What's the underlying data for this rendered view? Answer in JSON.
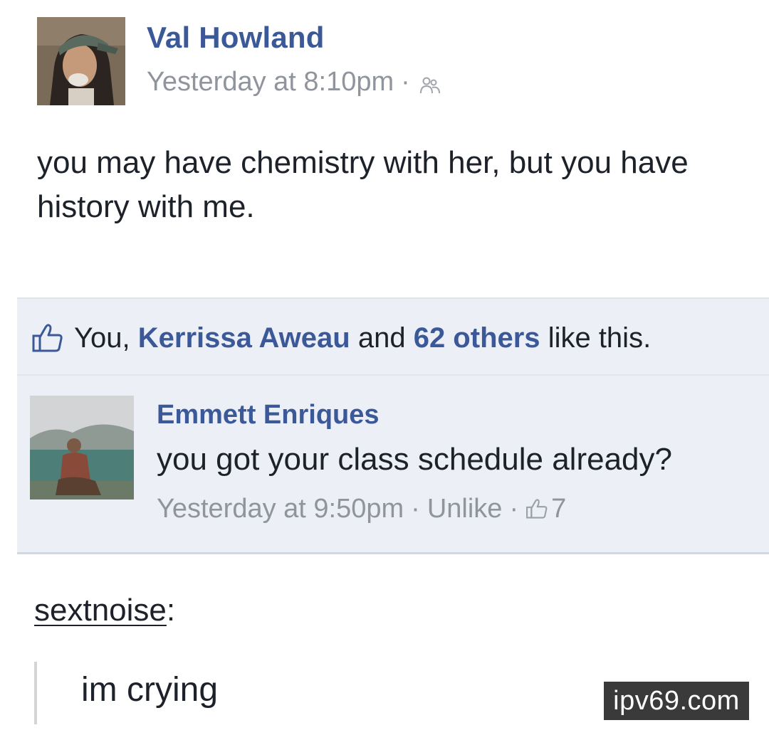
{
  "post": {
    "author": "Val Howland",
    "timestamp": "Yesterday at 8:10pm",
    "separator": "·",
    "audience_icon": "friends-icon",
    "text": "you may have chemistry with her, but you have history with me."
  },
  "likes": {
    "icon": "thumbs-up-icon",
    "prefix": "You,",
    "friend": "Kerrissa Aweau",
    "middle": "and",
    "others": "62 others",
    "suffix": "like this."
  },
  "comment": {
    "author": "Emmett Enriques",
    "text": "you got your class schedule already?",
    "timestamp": "Yesterday at 9:50pm",
    "separator": "·",
    "action": "Unlike",
    "like_count": "7"
  },
  "reblog": {
    "username": "sextnoise",
    "colon": ":",
    "quote": "im crying"
  },
  "watermark": "ipv69.com",
  "colors": {
    "link_blue": "#3b5998",
    "meta_gray": "#90949c",
    "ufi_background": "#eceff5"
  }
}
